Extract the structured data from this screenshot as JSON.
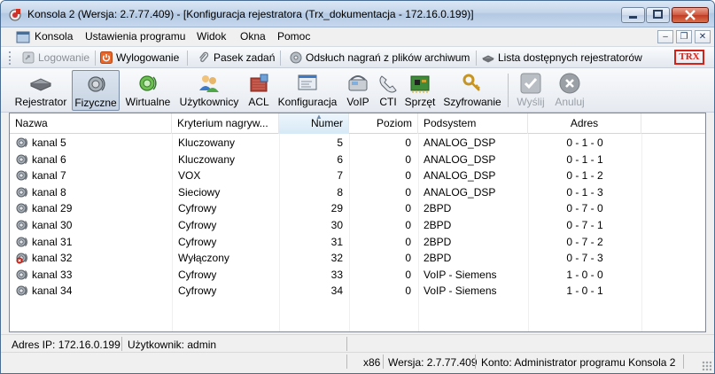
{
  "window": {
    "title": "Konsola 2 (Wersja:  2.7.77.409) - [Konfiguracja rejestratora (Trx_dokumentacja - 172.16.0.199)]",
    "min_symbol": "▁",
    "max_symbol": "▢",
    "close_symbol": "✕"
  },
  "menu": {
    "items": [
      "Konsola",
      "Ustawienia programu",
      "Widok",
      "Okna",
      "Pomoc"
    ],
    "mdi_min": "–",
    "mdi_restore": "❐",
    "mdi_close": "✕"
  },
  "toolbar1": {
    "login": "Logowanie",
    "logout": "Wylogowanie",
    "taskbar": "Pasek zadań",
    "playback": "Odsłuch nagrań z plików archiwum",
    "recorders": "Lista dostępnych rejestratorów",
    "logo": "TRX"
  },
  "toolbar2": {
    "buttons": [
      {
        "label": "Rejestrator",
        "icon": "recorder-icon"
      },
      {
        "label": "Fizyczne",
        "icon": "physical-channels-icon"
      },
      {
        "label": "Wirtualne",
        "icon": "virtual-channels-icon"
      },
      {
        "label": "Użytkownicy",
        "icon": "users-icon"
      },
      {
        "label": "ACL",
        "icon": "acl-icon"
      },
      {
        "label": "Konfiguracja",
        "icon": "configuration-icon"
      },
      {
        "label": "VoIP",
        "icon": "voip-icon"
      },
      {
        "label": "CTI",
        "icon": "cti-icon"
      },
      {
        "label": "Sprzęt",
        "icon": "hardware-icon"
      },
      {
        "label": "Szyfrowanie",
        "icon": "encryption-icon"
      },
      {
        "label": "Wyślij",
        "icon": "send-icon"
      },
      {
        "label": "Anuluj",
        "icon": "cancel-icon"
      }
    ]
  },
  "table": {
    "columns": [
      "Nazwa",
      "Kryterium nagryw...",
      "Numer",
      "Poziom",
      "Podsystem",
      "Adres"
    ],
    "rows": [
      {
        "name": "kanal 5",
        "criterion": "Kluczowany",
        "number": "5",
        "level": "0",
        "subsystem": "ANALOG_DSP",
        "address": "0 - 1 - 0",
        "icon": "channel-icon"
      },
      {
        "name": "kanal 6",
        "criterion": "Kluczowany",
        "number": "6",
        "level": "0",
        "subsystem": "ANALOG_DSP",
        "address": "0 - 1 - 1",
        "icon": "channel-icon"
      },
      {
        "name": "kanal 7",
        "criterion": "VOX",
        "number": "7",
        "level": "0",
        "subsystem": "ANALOG_DSP",
        "address": "0 - 1 - 2",
        "icon": "channel-icon"
      },
      {
        "name": "kanal 8",
        "criterion": "Sieciowy",
        "number": "8",
        "level": "0",
        "subsystem": "ANALOG_DSP",
        "address": "0 - 1 - 3",
        "icon": "channel-icon"
      },
      {
        "name": "kanal 29",
        "criterion": "Cyfrowy",
        "number": "29",
        "level": "0",
        "subsystem": "2BPD",
        "address": "0 - 7 - 0",
        "icon": "channel-icon"
      },
      {
        "name": "kanal 30",
        "criterion": "Cyfrowy",
        "number": "30",
        "level": "0",
        "subsystem": "2BPD",
        "address": "0 - 7 - 1",
        "icon": "channel-icon"
      },
      {
        "name": "kanal 31",
        "criterion": "Cyfrowy",
        "number": "31",
        "level": "0",
        "subsystem": "2BPD",
        "address": "0 - 7 - 2",
        "icon": "channel-icon"
      },
      {
        "name": "kanal 32",
        "criterion": "Wyłączony",
        "number": "32",
        "level": "0",
        "subsystem": "2BPD",
        "address": "0 - 7 - 3",
        "icon": "channel-disabled-icon"
      },
      {
        "name": "kanal 33",
        "criterion": "Cyfrowy",
        "number": "33",
        "level": "0",
        "subsystem": "VoIP - Siemens",
        "address": "1 - 0 - 0",
        "icon": "channel-icon"
      },
      {
        "name": "kanal 34",
        "criterion": "Cyfrowy",
        "number": "34",
        "level": "0",
        "subsystem": "VoIP - Siemens",
        "address": "1 - 0 - 1",
        "icon": "channel-icon"
      }
    ]
  },
  "status": {
    "ip": "Adres IP: 172.16.0.199",
    "user": "Użytkownik: admin",
    "arch": "x86",
    "version": "Wersja: 2.7.77.409",
    "account": "Konto: Administrator programu Konsola 2"
  }
}
